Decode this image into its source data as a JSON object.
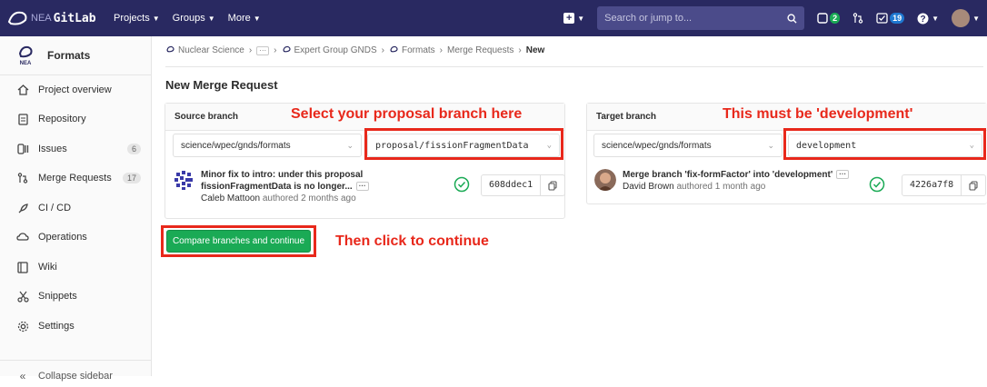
{
  "topbar": {
    "brand_nea": "NEA",
    "brand_name": "GitLab",
    "nav": [
      "Projects",
      "Groups",
      "More"
    ],
    "search_placeholder": "Search or jump to...",
    "issues_count": "2",
    "todos_count": "19"
  },
  "sidebar": {
    "project_name": "Formats",
    "project_avatar_text": "NEA",
    "items": [
      {
        "label": "Project overview",
        "icon": "home-icon"
      },
      {
        "label": "Repository",
        "icon": "doc-icon"
      },
      {
        "label": "Issues",
        "icon": "issues-icon",
        "count": "6"
      },
      {
        "label": "Merge Requests",
        "icon": "merge-request-icon",
        "count": "17"
      },
      {
        "label": "CI / CD",
        "icon": "rocket-icon"
      },
      {
        "label": "Operations",
        "icon": "cloud-icon"
      },
      {
        "label": "Wiki",
        "icon": "book-icon"
      },
      {
        "label": "Snippets",
        "icon": "scissors-icon"
      },
      {
        "label": "Settings",
        "icon": "gear-icon"
      }
    ],
    "collapse_label": "Collapse sidebar"
  },
  "breadcrumb": {
    "items": [
      "Nuclear Science",
      "Expert Group GNDS",
      "Formats",
      "Merge Requests",
      "New"
    ]
  },
  "page": {
    "title": "New Merge Request",
    "compare_button": "Compare branches and continue"
  },
  "source": {
    "heading": "Source branch",
    "project": "science/wpec/gnds/formats",
    "branch": "proposal/fissionFragmentData",
    "commit_title_1": "Minor fix to intro: under this proposal",
    "commit_title_2": "fissionFragmentData is no longer...",
    "commit_author": "Caleb Mattoon",
    "commit_when": "authored 2 months ago",
    "sha": "608ddec1"
  },
  "target": {
    "heading": "Target branch",
    "project": "science/wpec/gnds/formats",
    "branch": "development",
    "commit_title": "Merge branch 'fix-formFactor' into 'development'",
    "commit_author": "David Brown",
    "commit_when": "authored 1 month ago",
    "sha": "4226a7f8"
  },
  "annotations": {
    "source": "Select your proposal branch here",
    "target": "This must be 'development'",
    "continue": "Then click to continue"
  },
  "colors": {
    "topbar": "#292961",
    "annotation_red": "#e8281b",
    "button_green": "#1aaa55"
  }
}
